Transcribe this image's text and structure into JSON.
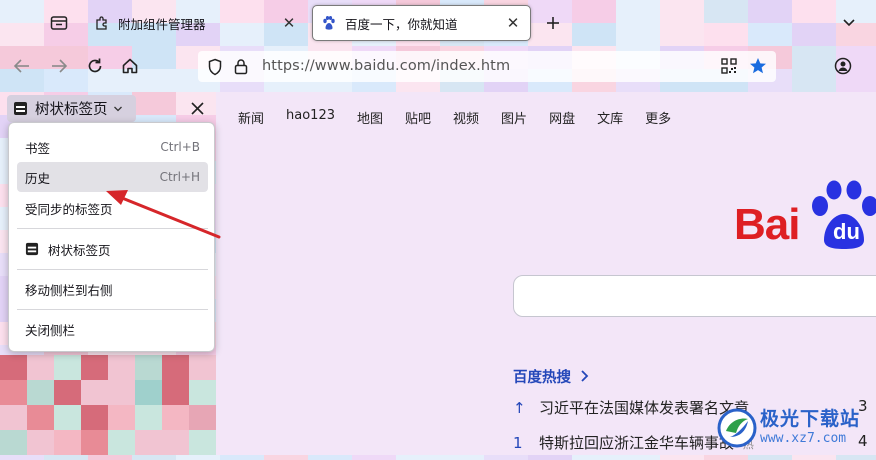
{
  "tabs": {
    "firefox_view_icon": "firefox-view-icon",
    "items": [
      {
        "title": "附加组件管理器",
        "icon": "puzzle-icon",
        "active": false
      },
      {
        "title": "百度一下，你就知道",
        "icon": "paw-icon",
        "active": true
      }
    ],
    "new_tab_icon": "plus-icon",
    "list_all_tabs_icon": "chevron-down-icon"
  },
  "navbar": {
    "url": "https://www.baidu.com/index.htm",
    "icons": [
      "back-icon",
      "forward-icon",
      "reload-icon",
      "home-icon",
      "shield-icon",
      "lock-icon",
      "qr-code-icon",
      "star-icon",
      "account-icon"
    ]
  },
  "sidebar": {
    "switcher_label": "树状标签页",
    "close_icon": "close-icon"
  },
  "menu": {
    "items": [
      {
        "label": "书签",
        "shortcut": "Ctrl+B"
      },
      {
        "label": "历史",
        "shortcut": "Ctrl+H",
        "highlighted": true
      },
      {
        "label": "受同步的标签页",
        "shortcut": ""
      },
      {
        "label": "树状标签页",
        "shortcut": "",
        "icon": "tree-tabs-icon"
      },
      {
        "label": "移动侧栏到右侧",
        "shortcut": ""
      },
      {
        "label": "关闭侧栏",
        "shortcut": ""
      }
    ]
  },
  "content": {
    "top_links": [
      "新闻",
      "hao123",
      "地图",
      "贴吧",
      "视频",
      "图片",
      "网盘",
      "文库",
      "更多"
    ],
    "logo_text": "Bai",
    "logo_du": "du",
    "hot_title": "百度热搜",
    "hot_items": [
      {
        "rank": "↑",
        "text": "习近平在法国媒体发表署名文章",
        "num": "3"
      },
      {
        "rank": "1",
        "text": "特斯拉回应浙江金华车辆事故",
        "num": "4"
      }
    ]
  },
  "watermark": {
    "name": "极光下载站",
    "url": "www.xz7.com"
  },
  "colors": {
    "accent_blue": "#2447b9",
    "baidu_red": "#de1f23",
    "arrow_red": "#d6262a"
  }
}
